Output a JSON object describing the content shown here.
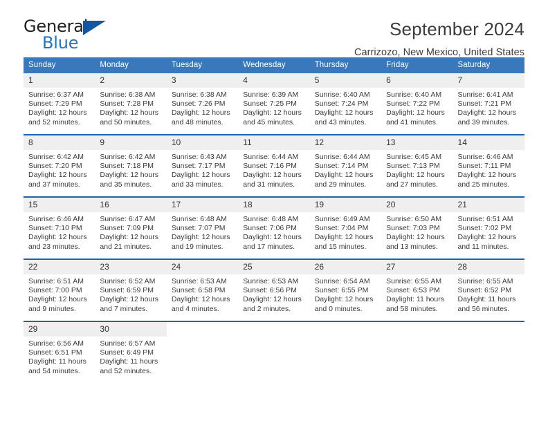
{
  "brand": {
    "name_part1": "General",
    "name_part2": "Blue",
    "flag_icon": "brand-flag-icon"
  },
  "header": {
    "title": "September 2024",
    "location": "Carrizozo, New Mexico, United States"
  },
  "colors": {
    "header_blue": "#3a78bc",
    "row_divider_blue": "#1b63ad",
    "daynum_background": "#efefef",
    "brand_blue": "#1d76c4",
    "brand_flag": "#1257a0",
    "text": "#3a3a3a"
  },
  "weekday_headers": [
    "Sunday",
    "Monday",
    "Tuesday",
    "Wednesday",
    "Thursday",
    "Friday",
    "Saturday"
  ],
  "labels": {
    "sunrise_prefix": "Sunrise:",
    "sunset_prefix": "Sunset:",
    "daylight_prefix": "Daylight:"
  },
  "weeks": [
    [
      {
        "day": "1",
        "sunrise": "Sunrise: 6:37 AM",
        "sunset": "Sunset: 7:29 PM",
        "daylight_line1": "Daylight: 12 hours",
        "daylight_line2": "and 52 minutes."
      },
      {
        "day": "2",
        "sunrise": "Sunrise: 6:38 AM",
        "sunset": "Sunset: 7:28 PM",
        "daylight_line1": "Daylight: 12 hours",
        "daylight_line2": "and 50 minutes."
      },
      {
        "day": "3",
        "sunrise": "Sunrise: 6:38 AM",
        "sunset": "Sunset: 7:26 PM",
        "daylight_line1": "Daylight: 12 hours",
        "daylight_line2": "and 48 minutes."
      },
      {
        "day": "4",
        "sunrise": "Sunrise: 6:39 AM",
        "sunset": "Sunset: 7:25 PM",
        "daylight_line1": "Daylight: 12 hours",
        "daylight_line2": "and 45 minutes."
      },
      {
        "day": "5",
        "sunrise": "Sunrise: 6:40 AM",
        "sunset": "Sunset: 7:24 PM",
        "daylight_line1": "Daylight: 12 hours",
        "daylight_line2": "and 43 minutes."
      },
      {
        "day": "6",
        "sunrise": "Sunrise: 6:40 AM",
        "sunset": "Sunset: 7:22 PM",
        "daylight_line1": "Daylight: 12 hours",
        "daylight_line2": "and 41 minutes."
      },
      {
        "day": "7",
        "sunrise": "Sunrise: 6:41 AM",
        "sunset": "Sunset: 7:21 PM",
        "daylight_line1": "Daylight: 12 hours",
        "daylight_line2": "and 39 minutes."
      }
    ],
    [
      {
        "day": "8",
        "sunrise": "Sunrise: 6:42 AM",
        "sunset": "Sunset: 7:20 PM",
        "daylight_line1": "Daylight: 12 hours",
        "daylight_line2": "and 37 minutes."
      },
      {
        "day": "9",
        "sunrise": "Sunrise: 6:42 AM",
        "sunset": "Sunset: 7:18 PM",
        "daylight_line1": "Daylight: 12 hours",
        "daylight_line2": "and 35 minutes."
      },
      {
        "day": "10",
        "sunrise": "Sunrise: 6:43 AM",
        "sunset": "Sunset: 7:17 PM",
        "daylight_line1": "Daylight: 12 hours",
        "daylight_line2": "and 33 minutes."
      },
      {
        "day": "11",
        "sunrise": "Sunrise: 6:44 AM",
        "sunset": "Sunset: 7:16 PM",
        "daylight_line1": "Daylight: 12 hours",
        "daylight_line2": "and 31 minutes."
      },
      {
        "day": "12",
        "sunrise": "Sunrise: 6:44 AM",
        "sunset": "Sunset: 7:14 PM",
        "daylight_line1": "Daylight: 12 hours",
        "daylight_line2": "and 29 minutes."
      },
      {
        "day": "13",
        "sunrise": "Sunrise: 6:45 AM",
        "sunset": "Sunset: 7:13 PM",
        "daylight_line1": "Daylight: 12 hours",
        "daylight_line2": "and 27 minutes."
      },
      {
        "day": "14",
        "sunrise": "Sunrise: 6:46 AM",
        "sunset": "Sunset: 7:11 PM",
        "daylight_line1": "Daylight: 12 hours",
        "daylight_line2": "and 25 minutes."
      }
    ],
    [
      {
        "day": "15",
        "sunrise": "Sunrise: 6:46 AM",
        "sunset": "Sunset: 7:10 PM",
        "daylight_line1": "Daylight: 12 hours",
        "daylight_line2": "and 23 minutes."
      },
      {
        "day": "16",
        "sunrise": "Sunrise: 6:47 AM",
        "sunset": "Sunset: 7:09 PM",
        "daylight_line1": "Daylight: 12 hours",
        "daylight_line2": "and 21 minutes."
      },
      {
        "day": "17",
        "sunrise": "Sunrise: 6:48 AM",
        "sunset": "Sunset: 7:07 PM",
        "daylight_line1": "Daylight: 12 hours",
        "daylight_line2": "and 19 minutes."
      },
      {
        "day": "18",
        "sunrise": "Sunrise: 6:48 AM",
        "sunset": "Sunset: 7:06 PM",
        "daylight_line1": "Daylight: 12 hours",
        "daylight_line2": "and 17 minutes."
      },
      {
        "day": "19",
        "sunrise": "Sunrise: 6:49 AM",
        "sunset": "Sunset: 7:04 PM",
        "daylight_line1": "Daylight: 12 hours",
        "daylight_line2": "and 15 minutes."
      },
      {
        "day": "20",
        "sunrise": "Sunrise: 6:50 AM",
        "sunset": "Sunset: 7:03 PM",
        "daylight_line1": "Daylight: 12 hours",
        "daylight_line2": "and 13 minutes."
      },
      {
        "day": "21",
        "sunrise": "Sunrise: 6:51 AM",
        "sunset": "Sunset: 7:02 PM",
        "daylight_line1": "Daylight: 12 hours",
        "daylight_line2": "and 11 minutes."
      }
    ],
    [
      {
        "day": "22",
        "sunrise": "Sunrise: 6:51 AM",
        "sunset": "Sunset: 7:00 PM",
        "daylight_line1": "Daylight: 12 hours",
        "daylight_line2": "and 9 minutes."
      },
      {
        "day": "23",
        "sunrise": "Sunrise: 6:52 AM",
        "sunset": "Sunset: 6:59 PM",
        "daylight_line1": "Daylight: 12 hours",
        "daylight_line2": "and 7 minutes."
      },
      {
        "day": "24",
        "sunrise": "Sunrise: 6:53 AM",
        "sunset": "Sunset: 6:58 PM",
        "daylight_line1": "Daylight: 12 hours",
        "daylight_line2": "and 4 minutes."
      },
      {
        "day": "25",
        "sunrise": "Sunrise: 6:53 AM",
        "sunset": "Sunset: 6:56 PM",
        "daylight_line1": "Daylight: 12 hours",
        "daylight_line2": "and 2 minutes."
      },
      {
        "day": "26",
        "sunrise": "Sunrise: 6:54 AM",
        "sunset": "Sunset: 6:55 PM",
        "daylight_line1": "Daylight: 12 hours",
        "daylight_line2": "and 0 minutes."
      },
      {
        "day": "27",
        "sunrise": "Sunrise: 6:55 AM",
        "sunset": "Sunset: 6:53 PM",
        "daylight_line1": "Daylight: 11 hours",
        "daylight_line2": "and 58 minutes."
      },
      {
        "day": "28",
        "sunrise": "Sunrise: 6:55 AM",
        "sunset": "Sunset: 6:52 PM",
        "daylight_line1": "Daylight: 11 hours",
        "daylight_line2": "and 56 minutes."
      }
    ],
    [
      {
        "day": "29",
        "sunrise": "Sunrise: 6:56 AM",
        "sunset": "Sunset: 6:51 PM",
        "daylight_line1": "Daylight: 11 hours",
        "daylight_line2": "and 54 minutes."
      },
      {
        "day": "30",
        "sunrise": "Sunrise: 6:57 AM",
        "sunset": "Sunset: 6:49 PM",
        "daylight_line1": "Daylight: 11 hours",
        "daylight_line2": "and 52 minutes."
      },
      {
        "day": "",
        "sunrise": "",
        "sunset": "",
        "daylight_line1": "",
        "daylight_line2": ""
      },
      {
        "day": "",
        "sunrise": "",
        "sunset": "",
        "daylight_line1": "",
        "daylight_line2": ""
      },
      {
        "day": "",
        "sunrise": "",
        "sunset": "",
        "daylight_line1": "",
        "daylight_line2": ""
      },
      {
        "day": "",
        "sunrise": "",
        "sunset": "",
        "daylight_line1": "",
        "daylight_line2": ""
      },
      {
        "day": "",
        "sunrise": "",
        "sunset": "",
        "daylight_line1": "",
        "daylight_line2": ""
      }
    ]
  ]
}
